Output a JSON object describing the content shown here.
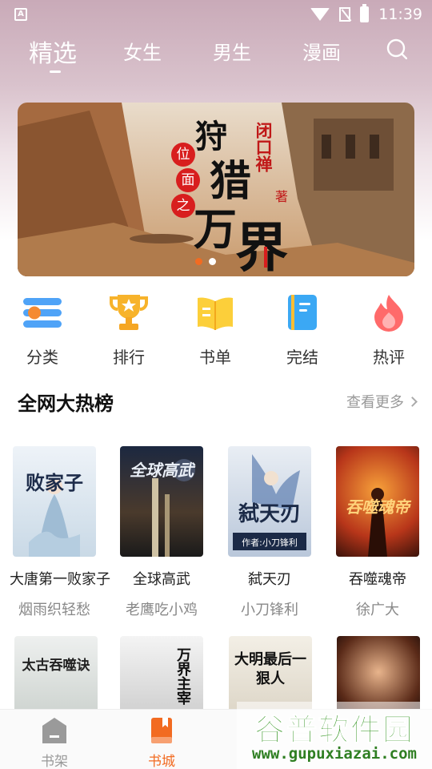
{
  "status_bar": {
    "time": "11:39",
    "left_badge": "A"
  },
  "tabs": [
    {
      "label": "精选",
      "active": true
    },
    {
      "label": "女生",
      "active": false
    },
    {
      "label": "男生",
      "active": false
    },
    {
      "label": "漫画",
      "active": false
    }
  ],
  "banner": {
    "title_chars": [
      "狩",
      "猎"
    ],
    "big_chars": [
      "万",
      "界"
    ],
    "seal_chars": [
      "位",
      "面",
      "之"
    ],
    "author": "闭口禅",
    "author_suffix": "著",
    "dots": 2,
    "active_dot": 0
  },
  "categories": [
    {
      "label": "分类",
      "icon": "menu-list-icon"
    },
    {
      "label": "排行",
      "icon": "trophy-icon"
    },
    {
      "label": "书单",
      "icon": "book-open-icon"
    },
    {
      "label": "完结",
      "icon": "book-closed-icon"
    },
    {
      "label": "热评",
      "icon": "flame-icon"
    }
  ],
  "section": {
    "title": "全网大热榜",
    "more": "查看更多"
  },
  "books": [
    {
      "title": "大唐第一败家子",
      "author": "烟雨织轻愁",
      "cover_text": "败家子"
    },
    {
      "title": "全球高武",
      "author": "老鹰吃小鸡",
      "cover_text": "全球高武"
    },
    {
      "title": "弑天刃",
      "author": "小刀锋利",
      "cover_text": "弑天刃",
      "cover_sub": "作者:小刀锋利"
    },
    {
      "title": "吞噬魂帝",
      "author": "徐广大",
      "cover_text": "吞噬魂帝"
    }
  ],
  "books_row2": [
    {
      "cover_text": "太古吞噬诀"
    },
    {
      "cover_text": "万界主宰"
    },
    {
      "cover_text": "大明最后一狠人"
    },
    {
      "cover_text": ""
    }
  ],
  "bottom_nav": [
    {
      "label": "书架",
      "active": false,
      "icon": "bookshelf-icon"
    },
    {
      "label": "书城",
      "active": true,
      "icon": "bookstore-icon"
    }
  ],
  "watermark": {
    "text": "谷普软件园",
    "url": "www.gupuxiazai.com"
  },
  "colors": {
    "accent": "#f26b21",
    "tab_text": "#ffffff",
    "muted": "#999999"
  }
}
